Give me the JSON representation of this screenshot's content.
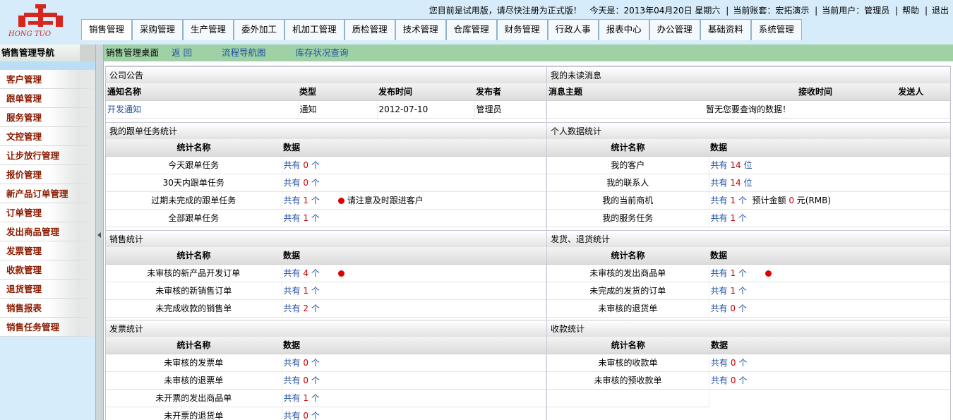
{
  "header": {
    "logo_text": "HONG TUO",
    "notice": "您目前是试用版，请尽快注册为正式版！",
    "today": "今天是：2013年04月20日  星期六",
    "account": "当前账套：宏拓演示",
    "user": "当前用户：管理员",
    "help": "帮助",
    "logout": "退出",
    "nav": [
      "销售管理",
      "采购管理",
      "生产管理",
      "委外加工",
      "机加工管理",
      "质检管理",
      "技术管理",
      "仓库管理",
      "财务管理",
      "行政人事",
      "报表中心",
      "办公管理",
      "基础资料",
      "系统管理"
    ]
  },
  "sidebar": {
    "title": "销售管理导航",
    "items": [
      "客户管理",
      "跟单管理",
      "服务管理",
      "文控管理",
      "让步放行管理",
      "报价管理",
      "新产品订单管理",
      "订单管理",
      "发出商品管理",
      "发票管理",
      "收款管理",
      "退货管理",
      "销售报表",
      "销售任务管理"
    ]
  },
  "breadcrumb": {
    "title": "销售管理桌面",
    "back": "返 回",
    "flow": "流程导航图",
    "stock": "库存状况查询"
  },
  "common": {
    "gong": "共有",
    "stat_name": "统计名称",
    "data": "数据"
  },
  "announce": {
    "title": "公司公告",
    "headers": [
      "通知名称",
      "类型",
      "发布时间",
      "发布者"
    ],
    "rows": [
      [
        "开发通知",
        "通知",
        "2012-07-10",
        "管理员"
      ]
    ]
  },
  "unread": {
    "title": "我的未读消息",
    "headers": [
      "消息主题",
      "接收时间",
      "发送人"
    ],
    "empty": "暂无您要查询的数据！"
  },
  "follow": {
    "title": "我的跟单任务统计",
    "rows": [
      {
        "name": "今天跟单任务",
        "num": "0",
        "unit": "个",
        "note": ""
      },
      {
        "name": "30天内跟单任务",
        "num": "0",
        "unit": "个",
        "note": ""
      },
      {
        "name": "过期未完成的跟单任务",
        "num": "1",
        "unit": "个",
        "note": "请注意及时跟进客户"
      },
      {
        "name": "全部跟单任务",
        "num": "1",
        "unit": "个",
        "note": ""
      }
    ]
  },
  "personal": {
    "title": "个人数据统计",
    "rows": [
      {
        "name": "我的客户",
        "num": "14",
        "unit": "位",
        "extra": ""
      },
      {
        "name": "我的联系人",
        "num": "14",
        "unit": "位",
        "extra": ""
      },
      {
        "name": "我的当前商机",
        "num": "1",
        "unit": "个",
        "extra_label": "预计金额",
        "extra_num": "0",
        "extra_unit": "元(RMB)"
      },
      {
        "name": "我的服务任务",
        "num": "1",
        "unit": "个",
        "extra": ""
      }
    ]
  },
  "sales": {
    "title": "销售统计",
    "rows": [
      {
        "name": "未审核的新产品开发订单",
        "num": "4",
        "unit": "个",
        "dot": true
      },
      {
        "name": "未审核的新销售订单",
        "num": "1",
        "unit": "个",
        "dot": false
      },
      {
        "name": "未完成收款的销售单",
        "num": "2",
        "unit": "个",
        "dot": false
      }
    ]
  },
  "ship": {
    "title": "发货、退货统计",
    "rows": [
      {
        "name": "未审核的发出商品单",
        "num": "1",
        "unit": "个",
        "dot": true
      },
      {
        "name": "未完成的发货的订单",
        "num": "1",
        "unit": "个",
        "dot": false
      },
      {
        "name": "未审核的退货单",
        "num": "0",
        "unit": "个",
        "dot": false
      }
    ]
  },
  "invoice": {
    "title": "发票统计",
    "rows": [
      {
        "name": "未审核的发票单",
        "num": "0",
        "unit": "个"
      },
      {
        "name": "未审核的退票单",
        "num": "0",
        "unit": "个"
      },
      {
        "name": "未开票的发出商品单",
        "num": "1",
        "unit": "个"
      },
      {
        "name": "未开票的退货单",
        "num": "0",
        "unit": "个"
      }
    ]
  },
  "receipt": {
    "title": "收款统计",
    "rows": [
      {
        "name": "未审核的收款单",
        "num": "0",
        "unit": "个"
      },
      {
        "name": "未审核的预收款单",
        "num": "0",
        "unit": "个"
      }
    ]
  },
  "colors": {
    "accent": "#cc0000",
    "link": "#1f4fa3",
    "header_bg": "#d6ecfa",
    "bread_bg": "#9ed2a5"
  },
  "icons": {
    "logo": "logo-icon",
    "dot": "alert-dot-icon",
    "collapse": "collapse-arrow-icon"
  }
}
